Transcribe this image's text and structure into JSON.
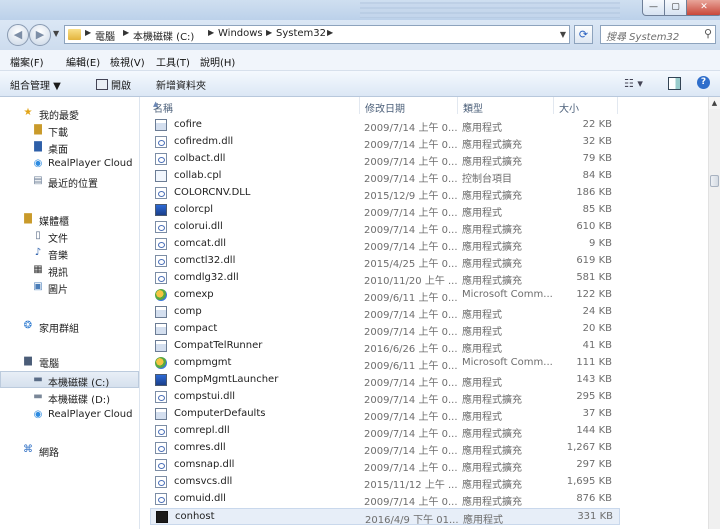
{
  "window": {
    "controls": {
      "minimize": "—",
      "maximize": "▢",
      "close": "✕"
    }
  },
  "address": {
    "crumbs": [
      "電腦",
      "本機磁碟 (C:)",
      "Windows",
      "System32"
    ],
    "search_placeholder": "搜尋 System32"
  },
  "menu": [
    "檔案(F)",
    "編輯(E)",
    "檢視(V)",
    "工具(T)",
    "說明(H)"
  ],
  "toolbar": {
    "organize": "組合管理 ▼",
    "open": "開啟",
    "new_folder": "新增資料夾"
  },
  "nav": {
    "favorites": "我的最愛",
    "fav_items": [
      "下載",
      "桌面",
      "RealPlayer Cloud",
      "最近的位置"
    ],
    "libraries": "媒體櫃",
    "lib_items": [
      "文件",
      "音樂",
      "視訊",
      "圖片"
    ],
    "homegroup": "家用群組",
    "computer": "電腦",
    "comp_items": [
      "本機磁碟 (C:)",
      "本機磁碟 (D:)",
      "RealPlayer Cloud"
    ],
    "network": "網路"
  },
  "columns": {
    "name": "名稱",
    "date": "修改日期",
    "type": "類型",
    "size": "大小"
  },
  "files": [
    {
      "name": "cofire",
      "date": "2009/7/14 上午 0...",
      "type": "應用程式",
      "size": "22 KB",
      "icon": "exe"
    },
    {
      "name": "cofiredm.dll",
      "date": "2009/7/14 上午 0...",
      "type": "應用程式擴充",
      "size": "32 KB",
      "icon": "dll"
    },
    {
      "name": "colbact.dll",
      "date": "2009/7/14 上午 0...",
      "type": "應用程式擴充",
      "size": "79 KB",
      "icon": "dll"
    },
    {
      "name": "collab.cpl",
      "date": "2009/7/14 上午 0...",
      "type": "控制台項目",
      "size": "84 KB",
      "icon": "cpl"
    },
    {
      "name": "COLORCNV.DLL",
      "date": "2015/12/9 上午 0...",
      "type": "應用程式擴充",
      "size": "186 KB",
      "icon": "dll"
    },
    {
      "name": "colorcpl",
      "date": "2009/7/14 上午 0...",
      "type": "應用程式",
      "size": "85 KB",
      "icon": "app"
    },
    {
      "name": "colorui.dll",
      "date": "2009/7/14 上午 0...",
      "type": "應用程式擴充",
      "size": "610 KB",
      "icon": "dll"
    },
    {
      "name": "comcat.dll",
      "date": "2009/7/14 上午 0...",
      "type": "應用程式擴充",
      "size": "9 KB",
      "icon": "dll"
    },
    {
      "name": "comctl32.dll",
      "date": "2015/4/25 上午 0...",
      "type": "應用程式擴充",
      "size": "619 KB",
      "icon": "dll"
    },
    {
      "name": "comdlg32.dll",
      "date": "2010/11/20 上午 ...",
      "type": "應用程式擴充",
      "size": "581 KB",
      "icon": "dll"
    },
    {
      "name": "comexp",
      "date": "2009/6/11 上午 0...",
      "type": "Microsoft Comm...",
      "size": "122 KB",
      "icon": "multi"
    },
    {
      "name": "comp",
      "date": "2009/7/14 上午 0...",
      "type": "應用程式",
      "size": "24 KB",
      "icon": "exe"
    },
    {
      "name": "compact",
      "date": "2009/7/14 上午 0...",
      "type": "應用程式",
      "size": "20 KB",
      "icon": "exe"
    },
    {
      "name": "CompatTelRunner",
      "date": "2016/6/26 上午 0...",
      "type": "應用程式",
      "size": "41 KB",
      "icon": "exe"
    },
    {
      "name": "compmgmt",
      "date": "2009/6/11 上午 0...",
      "type": "Microsoft Comm...",
      "size": "111 KB",
      "icon": "multi"
    },
    {
      "name": "CompMgmtLauncher",
      "date": "2009/7/14 上午 0...",
      "type": "應用程式",
      "size": "143 KB",
      "icon": "app"
    },
    {
      "name": "compstui.dll",
      "date": "2009/7/14 上午 0...",
      "type": "應用程式擴充",
      "size": "295 KB",
      "icon": "dll"
    },
    {
      "name": "ComputerDefaults",
      "date": "2009/7/14 上午 0...",
      "type": "應用程式",
      "size": "37 KB",
      "icon": "exe"
    },
    {
      "name": "comrepl.dll",
      "date": "2009/7/14 上午 0...",
      "type": "應用程式擴充",
      "size": "144 KB",
      "icon": "dll"
    },
    {
      "name": "comres.dll",
      "date": "2009/7/14 上午 0...",
      "type": "應用程式擴充",
      "size": "1,267 KB",
      "icon": "dll"
    },
    {
      "name": "comsnap.dll",
      "date": "2009/7/14 上午 0...",
      "type": "應用程式擴充",
      "size": "297 KB",
      "icon": "dll"
    },
    {
      "name": "comsvcs.dll",
      "date": "2015/11/12 上午 ...",
      "type": "應用程式擴充",
      "size": "1,695 KB",
      "icon": "dll"
    },
    {
      "name": "comuid.dll",
      "date": "2009/7/14 上午 0...",
      "type": "應用程式擴充",
      "size": "876 KB",
      "icon": "dll"
    },
    {
      "name": "conhost",
      "date": "2016/4/9 下午 01...",
      "type": "應用程式",
      "size": "331 KB",
      "icon": "dark"
    }
  ],
  "selected_index": 23,
  "selected_drive": 0
}
